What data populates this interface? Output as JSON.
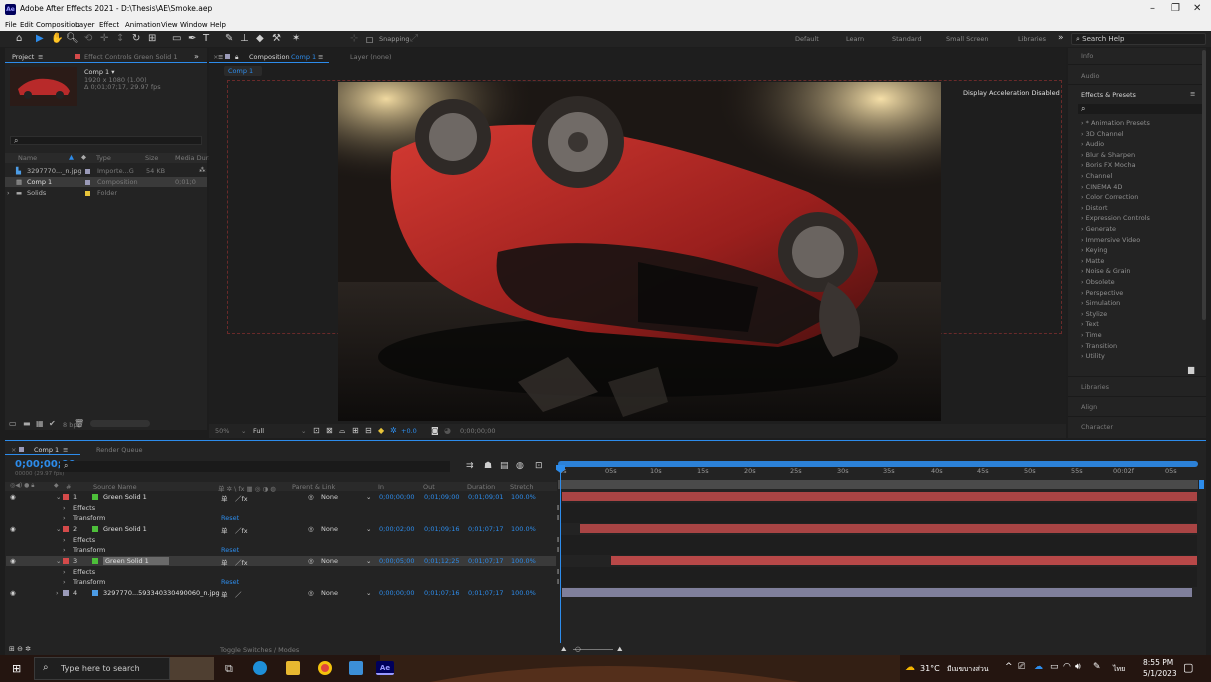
{
  "window": {
    "title": "Adobe After Effects 2021 - D:\\Thesis\\AE\\Smoke.aep",
    "logo": "Ae",
    "minimize": "–",
    "maximize": "❐",
    "close": "✕"
  },
  "menu": [
    "File",
    "Edit",
    "Composition",
    "Layer",
    "Effect",
    "Animation",
    "View",
    "Window",
    "Help"
  ],
  "toolbar": {
    "snapping": "Snapping",
    "workspaces": [
      "Default",
      "Learn",
      "Standard",
      "Small Screen",
      "Libraries"
    ],
    "more": "»",
    "search_placeholder": "Search Help"
  },
  "project": {
    "tab": "Project",
    "effect_controls_tab": "Effect Controls Green Solid 1",
    "comp_name": "Comp 1 ▾",
    "comp_size": "1920 x 1080 (1.00)",
    "comp_dur": "Δ 0;01;07;17, 29.97 fps",
    "search_icon": "⌕",
    "headers": {
      "name": "Name",
      "type": "Type",
      "size": "Size",
      "media": "Media Durat"
    },
    "items": [
      {
        "name": "3297770..._n.jpg",
        "type": "Importe...G",
        "size": "54 KB",
        "dur": ""
      },
      {
        "name": "Comp 1",
        "type": "Composition",
        "size": "",
        "dur": "0;01;0"
      },
      {
        "name": "Solids",
        "type": "Folder",
        "size": "",
        "dur": ""
      }
    ],
    "bpc": "8 bpc"
  },
  "composition": {
    "tab": "Composition",
    "tab_comp": "Comp 1",
    "layer_tab": "Layer (none)",
    "sub_tab": "Comp 1",
    "notice": "Display Acceleration Disabled",
    "zoom": "50%",
    "resolution": "Full",
    "exposure": "+0.0",
    "timecode": "0;00;00;00"
  },
  "right_panel": {
    "info": "Info",
    "audio": "Audio",
    "effects_presets": "Effects & Presets",
    "effects": [
      "* Animation Presets",
      "3D Channel",
      "Audio",
      "Blur & Sharpen",
      "Boris FX Mocha",
      "Channel",
      "CINEMA 4D",
      "Color Correction",
      "Distort",
      "Expression Controls",
      "Generate",
      "Immersive Video",
      "Keying",
      "Matte",
      "Noise & Grain",
      "Obsolete",
      "Perspective",
      "Simulation",
      "Stylize",
      "Text",
      "Time",
      "Transition",
      "Utility"
    ],
    "libraries": "Libraries",
    "align": "Align",
    "character": "Character"
  },
  "timeline": {
    "tab": "Comp 1",
    "render_queue": "Render Queue",
    "current_time": "0;00;00;00",
    "fps": "00000 (29.97 fps)",
    "columns": {
      "source": "Source Name",
      "switches": "单 ✲ \\ fx ▦ ◎ ◑ ◍",
      "parent": "Parent & Link",
      "in": "In",
      "out": "Out",
      "duration": "Duration",
      "stretch": "Stretch"
    },
    "ticks": [
      "0s",
      "05s",
      "10s",
      "15s",
      "20s",
      "25s",
      "30s",
      "35s",
      "40s",
      "45s",
      "50s",
      "55s",
      "00:02f",
      "05s"
    ],
    "layers": [
      {
        "num": "1",
        "name": "Green Solid 1",
        "parent": "None",
        "in": "0;00;00;00",
        "out": "0;01;09;00",
        "dur": "0;01;09;01",
        "stretch": "100.0%",
        "color": "#d44a4a",
        "label": "#4dbf3a"
      },
      {
        "num": "2",
        "name": "Green Solid 1",
        "parent": "None",
        "in": "0;00;02;00",
        "out": "0;01;09;16",
        "dur": "0;01;07;17",
        "stretch": "100.0%",
        "color": "#d44a4a",
        "label": "#4dbf3a"
      },
      {
        "num": "3",
        "name": "Green Solid 1",
        "parent": "None",
        "in": "0;00;05;00",
        "out": "0;01;12;25",
        "dur": "0;01;07;17",
        "stretch": "100.0%",
        "color": "#d44a4a",
        "label": "#4dbf3a"
      },
      {
        "num": "4",
        "name": "3297770...593340330490060_n.jpg",
        "parent": "None",
        "in": "0;00;00;00",
        "out": "0;01;07;16",
        "dur": "0;01;07;17",
        "stretch": "100.0%",
        "color": "#9a9ab8",
        "label": "#9a9ab8"
      }
    ],
    "effects_label": "Effects",
    "transform_label": "Transform",
    "reset": "Reset",
    "toggle": "Toggle Switches / Modes"
  },
  "taskbar": {
    "search": "Type here to search",
    "weather": "31°C",
    "weather_text": "มีเมฆบางส่วน",
    "lang": "ไทย",
    "time": "8:55 PM",
    "date": "5/1/2023"
  },
  "colors": {
    "accent": "#2d8ceb",
    "layer_red": "#d44a4a",
    "layer_purple": "#9a9ab8"
  }
}
